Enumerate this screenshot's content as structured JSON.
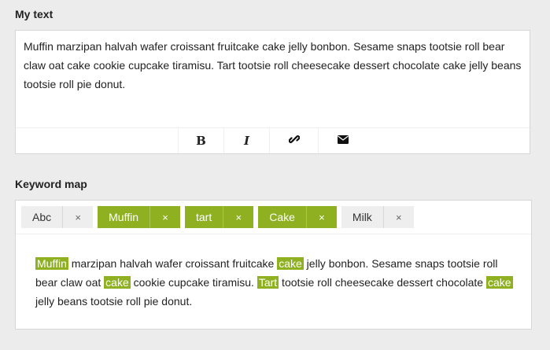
{
  "editor": {
    "label": "My text",
    "content": "Muffin marzipan halvah wafer croissant fruitcake cake jelly bonbon. Sesame snaps tootsie roll bear claw oat cake cookie cupcake tiramisu. Tart tootsie roll cheesecake dessert chocolate cake jelly beans tootsie roll pie donut.",
    "toolbar": {
      "bold": "B",
      "italic": "I",
      "link_icon": "link-icon",
      "mail_icon": "envelope-icon"
    }
  },
  "keyword_map": {
    "label": "Keyword map",
    "remove_symbol": "×",
    "tags": [
      {
        "label": "Abc",
        "active": false
      },
      {
        "label": "Muffin",
        "active": true
      },
      {
        "label": "tart",
        "active": true
      },
      {
        "label": "Cake",
        "active": true
      },
      {
        "label": "Milk",
        "active": false
      }
    ],
    "highlight_color": "#8eb021",
    "segments": [
      {
        "text": "Muffin",
        "highlight": true
      },
      {
        "text": " marzipan halvah wafer croissant fruitcake ",
        "highlight": false
      },
      {
        "text": "cake",
        "highlight": true
      },
      {
        "text": " jelly bonbon. Sesame snaps tootsie roll bear claw oat ",
        "highlight": false
      },
      {
        "text": "cake",
        "highlight": true
      },
      {
        "text": " cookie cupcake tiramisu. ",
        "highlight": false
      },
      {
        "text": "Tart",
        "highlight": true
      },
      {
        "text": " tootsie roll cheesecake dessert chocolate ",
        "highlight": false
      },
      {
        "text": "cake",
        "highlight": true
      },
      {
        "text": " jelly beans tootsie roll pie donut.",
        "highlight": false
      }
    ]
  }
}
